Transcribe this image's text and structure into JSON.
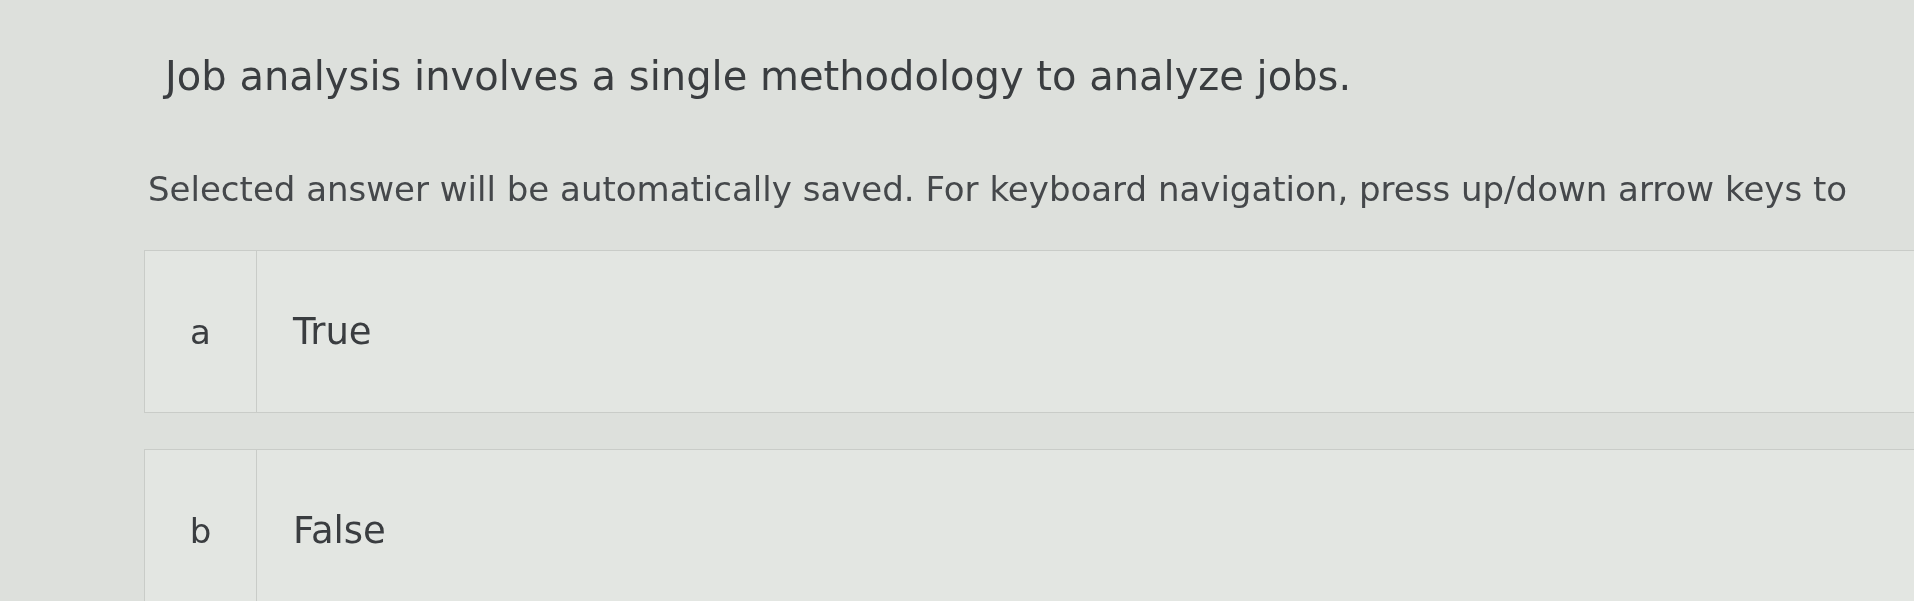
{
  "question": {
    "text": "Job analysis involves a single methodology to analyze jobs."
  },
  "instruction": "Selected answer will be automatically saved. For keyboard navigation, press up/down arrow keys to",
  "options": [
    {
      "letter": "a",
      "label": "True",
      "selected": false
    },
    {
      "letter": "b",
      "label": "False",
      "selected": false
    }
  ]
}
